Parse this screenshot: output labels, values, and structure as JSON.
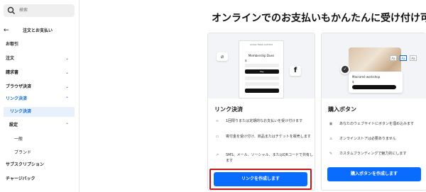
{
  "sidebar": {
    "search_placeholder": "検索",
    "back_icon": "arrow-left-icon",
    "section_title": "注文とお支払い",
    "items": [
      {
        "label": "お取引"
      },
      {
        "label": "注文"
      },
      {
        "label": "請求書"
      },
      {
        "label": "ブラウザ決済"
      },
      {
        "label": "リンク決済"
      },
      {
        "label": "リンク決済"
      },
      {
        "label": "設定"
      },
      {
        "label": "一般"
      },
      {
        "label": "ブランド"
      },
      {
        "label": "サブスクリプション"
      },
      {
        "label": "チャージバック"
      }
    ]
  },
  "main": {
    "title": "オンラインでのお支払いもかんたんに受け付け可能"
  },
  "link_card": {
    "mock_title": "Amber Table Golf Pint",
    "mock_subtitle": "Membership Dues",
    "mock_price": "$",
    "mock_pay_label": "Pay",
    "title": "リンク決済",
    "features": [
      {
        "icon": "link-icon",
        "text": "1回限りまたは定期的なお支払いを受け付けます"
      },
      {
        "icon": "ticket-icon",
        "text": "寄付金を受け付け、商品またはチケットを販売します"
      },
      {
        "icon": "share-icon",
        "text": "SMS、メール、ソーシャル、またはQRコードで共有します"
      }
    ],
    "cta": "リンクを作成します"
  },
  "buy_card": {
    "product_name": "Macramé workshop",
    "product_price": "$",
    "sizes": [
      "Aa",
      "Aa",
      "Aa"
    ],
    "title": "購入ボタン",
    "features": [
      {
        "icon": "browser-icon",
        "text": "あなたのウェブサイトにボタンを埋め込みます"
      },
      {
        "icon": "store-icon",
        "text": "オンラインストアは必要ありません"
      },
      {
        "icon": "pencil-icon",
        "text": "カスタムブランディングで魅力的にします"
      }
    ],
    "cta": "購入ボタンを作成します"
  },
  "colors": {
    "accent": "#0a6cff",
    "active_nav": "#0a66d6",
    "highlight_border": "#c8161d"
  }
}
